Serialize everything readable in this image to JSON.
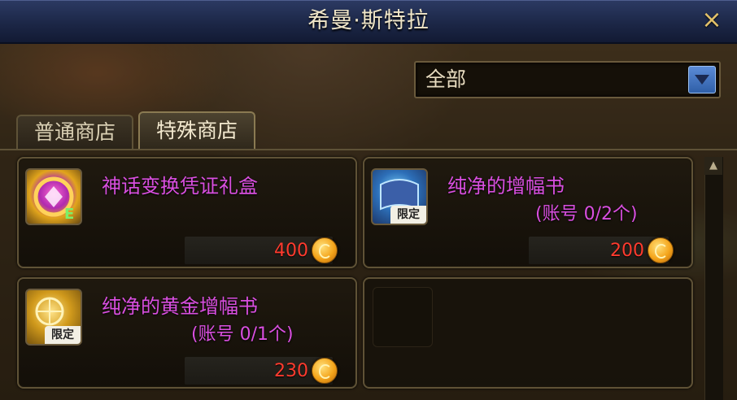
{
  "window": {
    "title": "希曼·斯特拉",
    "close_label": "×"
  },
  "filter": {
    "selected": "全部"
  },
  "tabs": [
    {
      "label": "普通商店",
      "active": false
    },
    {
      "label": "特殊商店",
      "active": true
    }
  ],
  "items": [
    {
      "name": "神话变换凭证礼盒",
      "sub": "",
      "price": "400",
      "limited": "",
      "icon": "mythic-transform-box-icon"
    },
    {
      "name": "纯净的增幅书",
      "sub": "(账号 0/2个)",
      "price": "200",
      "limited": "限定",
      "icon": "pure-amplify-book-icon"
    },
    {
      "name": "纯净的黄金增幅书",
      "sub": "(账号 0/1个)",
      "price": "230",
      "limited": "限定",
      "icon": "pure-golden-amplify-book-icon"
    }
  ],
  "colors": {
    "item_name": "#d94fe0",
    "price": "#ff3b2e",
    "titlebar": "#1c2747",
    "accent_gold": "#e3c26a"
  }
}
